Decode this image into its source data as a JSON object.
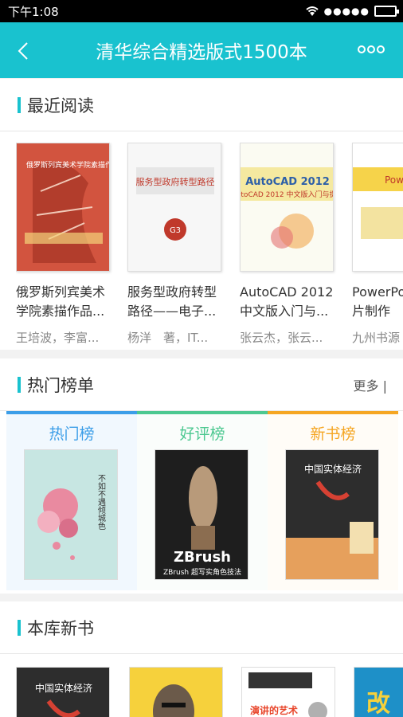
{
  "status": {
    "time": "下午1:08",
    "signal_dots": "●●●●●"
  },
  "appbar": {
    "title": "清华综合精选版式1500本",
    "back_icon": "chevron-left-icon",
    "more_icon": "more-dots-icon"
  },
  "colors": {
    "accent": "#19c2cf",
    "hot": "#3c9ee8",
    "good": "#4cc890",
    "new": "#f5a623"
  },
  "recent": {
    "heading": "最近阅读",
    "books": [
      {
        "title": "俄罗斯列宾美术学院素描作品...",
        "author": "王培波，李富...",
        "cover_text": "俄罗斯列宾美术学院素描作品精选系列"
      },
      {
        "title": "服务型政府转型路径——电子...",
        "author": "杨洋　著，IT...",
        "cover_text": "服务型政府转型路径"
      },
      {
        "title": "AutoCAD 2012中文版入门与...",
        "author": "张云杰，张云...",
        "cover_text": "AutoCAD 2012 中文版入门与提高"
      },
      {
        "title": "PowerPoint幻灯片制作",
        "author": "九州书源",
        "cover_text": "PowerPoint 幻灯"
      }
    ]
  },
  "hot": {
    "heading": "热门榜单",
    "more": "更多 |",
    "tabs": [
      {
        "label": "热门榜",
        "cover_text": "不如不遇倾城色"
      },
      {
        "label": "好评榜",
        "cover_text": "ZBrush 超写实角色技法"
      },
      {
        "label": "新书榜",
        "cover_text": "中国实体经济"
      }
    ]
  },
  "newbooks": {
    "heading": "本库新书",
    "covers": [
      "中国实体经济",
      "",
      "演讲的艺术",
      "改"
    ]
  }
}
